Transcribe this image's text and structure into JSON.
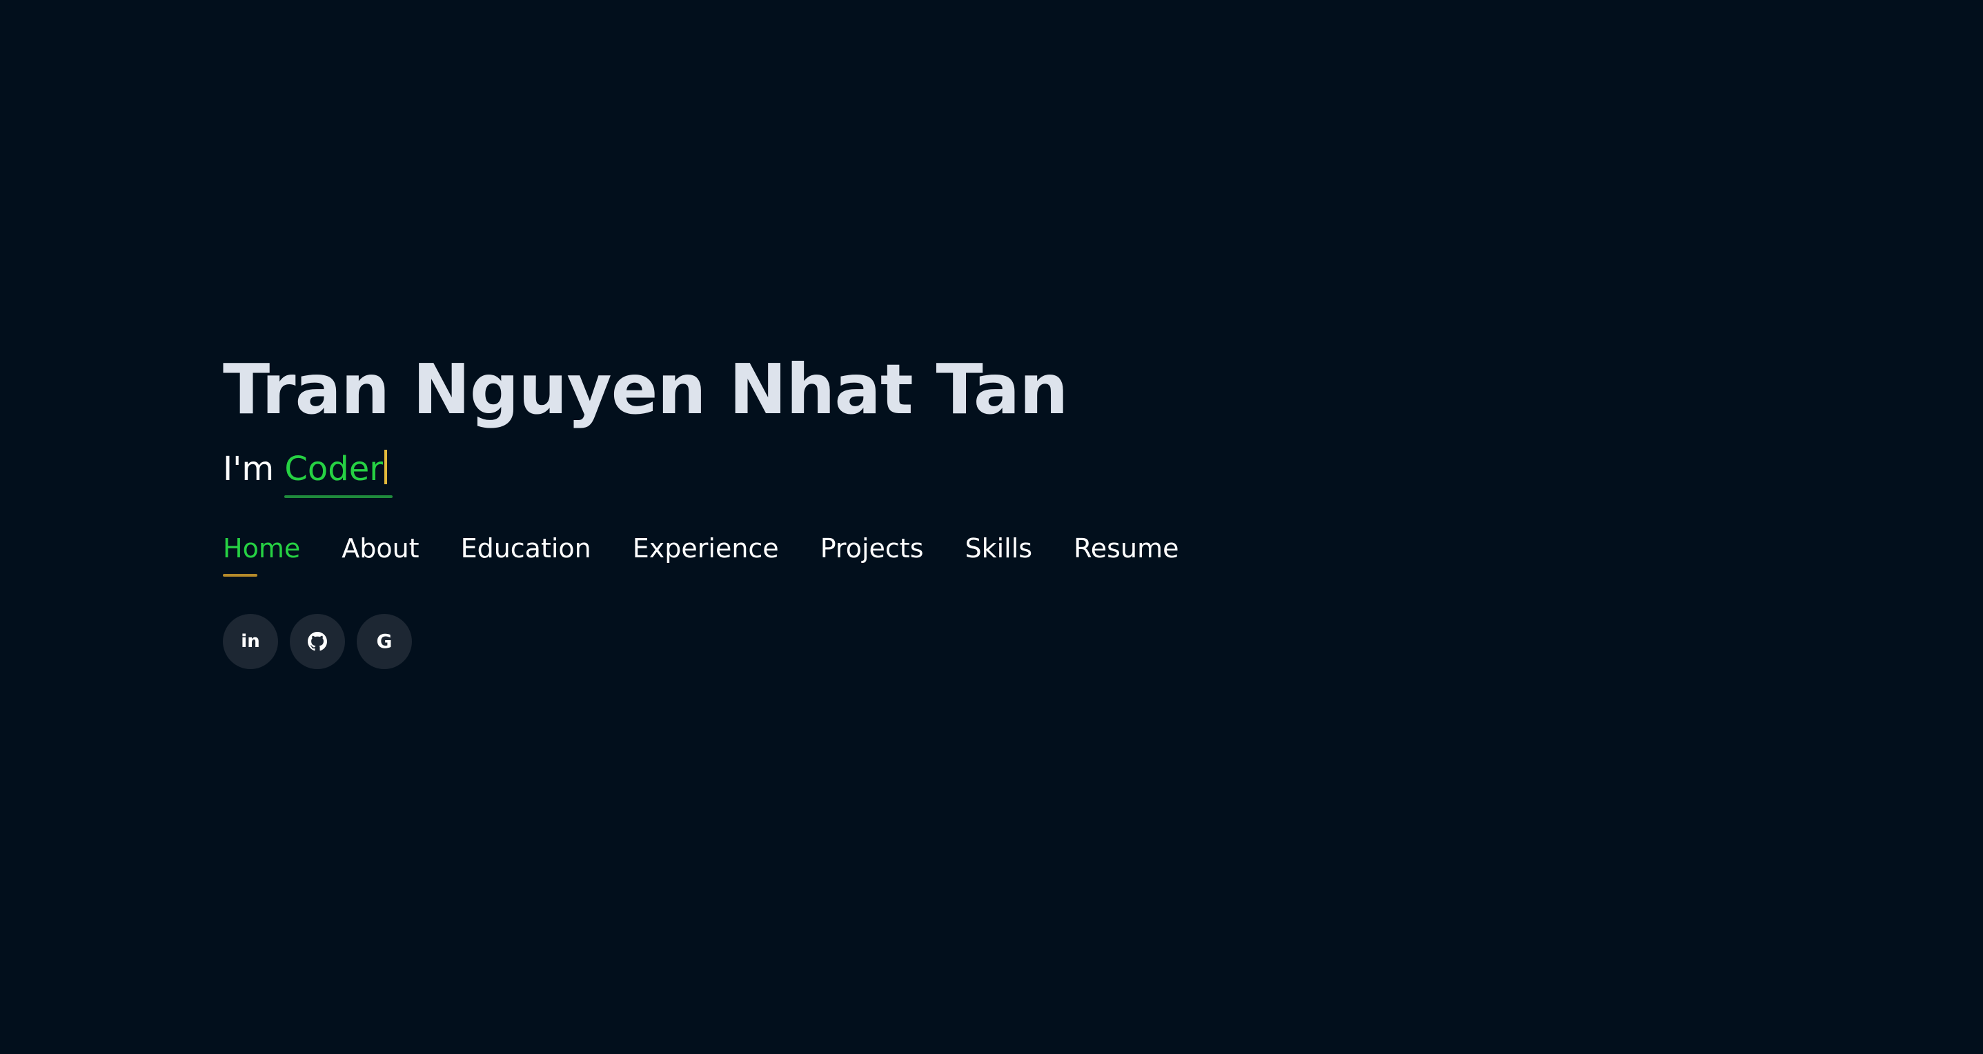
{
  "hero": {
    "name": "Tran Nguyen Nhat Tan",
    "tagline_prefix": "I'm ",
    "tagline_role": "Coder"
  },
  "nav": {
    "items": [
      {
        "label": "Home",
        "active": true
      },
      {
        "label": "About",
        "active": false
      },
      {
        "label": "Education",
        "active": false
      },
      {
        "label": "Experience",
        "active": false
      },
      {
        "label": "Projects",
        "active": false
      },
      {
        "label": "Skills",
        "active": false
      },
      {
        "label": "Resume",
        "active": false
      }
    ]
  },
  "socials": [
    {
      "icon": "linkedin-icon",
      "glyph": "in"
    },
    {
      "icon": "github-icon"
    },
    {
      "icon": "google-icon",
      "glyph": "G"
    }
  ],
  "colors": {
    "background": "#020f1c",
    "accent_green": "#26d143",
    "accent_gold": "#e2b93b",
    "heading": "#dde3ec",
    "social_bg": "#1d2733"
  }
}
